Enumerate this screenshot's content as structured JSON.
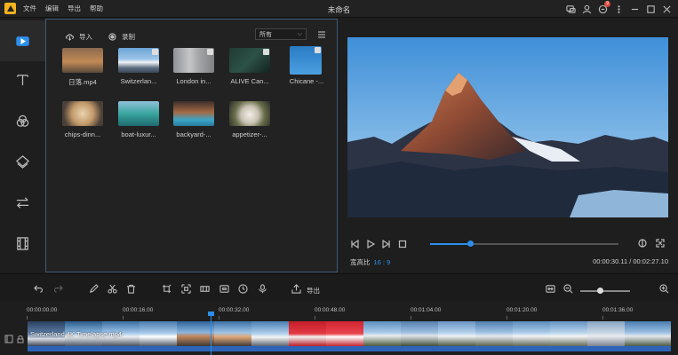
{
  "app": {
    "title": "未命名",
    "menu": [
      "文件",
      "编辑",
      "导出",
      "帮助"
    ],
    "notification_count": "9"
  },
  "media": {
    "import_label": "导入",
    "record_label": "录制",
    "filter_value": "所有",
    "items": [
      {
        "name": "日落.mp4"
      },
      {
        "name": "Switzerlan..."
      },
      {
        "name": "London in..."
      },
      {
        "name": "ALIVE  Can..."
      },
      {
        "name": "Chicane -..."
      },
      {
        "name": "chips-dinn..."
      },
      {
        "name": "boat-luxur..."
      },
      {
        "name": "backyard-..."
      },
      {
        "name": "appetizer-..."
      }
    ]
  },
  "preview": {
    "ratio_label": "宽高比",
    "ratio_value": "16 : 9",
    "time": "00:00:30.11 / 00:02:27.10",
    "progress": 0.21
  },
  "edit_toolbar": {
    "export_label": "导出",
    "zoom_level": 0.4
  },
  "timeline": {
    "ruler": [
      "00:00:00.00",
      "00:00:16.00",
      "00:00:32.00",
      "00:00:48.00",
      "00:01:04.00",
      "00:01:20.00",
      "00:01:36.00"
    ],
    "clip_label": "Switzerland 4K  Timelapse.mp4"
  },
  "colors": {
    "accent": "#2d8fea",
    "clip_bar": "#2d64b8"
  }
}
